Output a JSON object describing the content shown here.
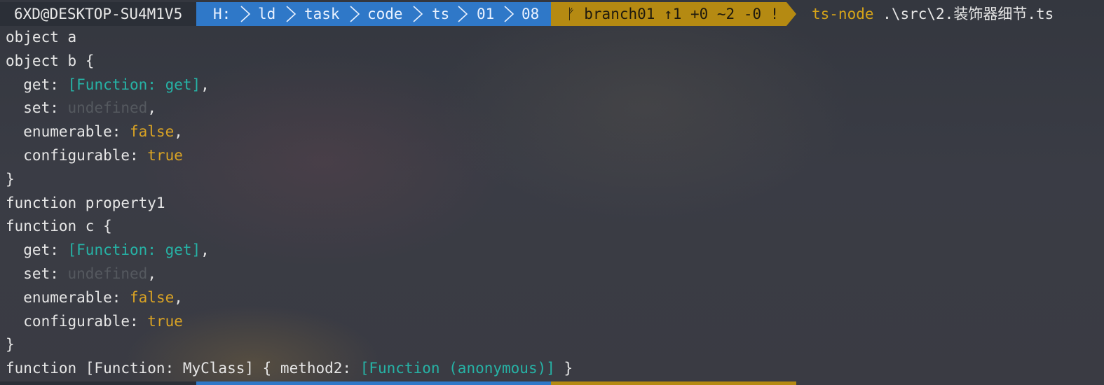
{
  "prompt": {
    "host": "6XD@DESKTOP-SU4M1V5",
    "path": [
      "H:",
      "ld",
      "task",
      "code",
      "ts",
      "01",
      "08"
    ],
    "git": {
      "icon": "git-branch-icon",
      "text": "branch01 ↑1 +0 ~2 -0 !"
    },
    "command": "ts-node",
    "argument": ".\\src\\2.装饰器细节.ts"
  },
  "colors": {
    "host_bg": "#2b2f37",
    "path_bg": "#2f78c8",
    "git_bg": "#b58a12",
    "command": "#d6a419",
    "function_literal": "#26b3a6",
    "undefined_literal": "#55595f",
    "boolean_literal": "#d9a324"
  },
  "output": {
    "l1": "object a",
    "l2": "object b {",
    "l3_key": "  get: ",
    "l3_val": "[Function: get]",
    "l3_end": ",",
    "l4_key": "  set: ",
    "l4_val": "undefined",
    "l4_end": ",",
    "l5_key": "  enumerable: ",
    "l5_val": "false",
    "l5_end": ",",
    "l6_key": "  configurable: ",
    "l6_val": "true",
    "l7": "}",
    "l8": "function property1",
    "l9": "function c {",
    "l10_key": "  get: ",
    "l10_val": "[Function: get]",
    "l10_end": ",",
    "l11_key": "  set: ",
    "l11_val": "undefined",
    "l11_end": ",",
    "l12_key": "  enumerable: ",
    "l12_val": "false",
    "l12_end": ",",
    "l13_key": "  configurable: ",
    "l13_val": "true",
    "l14": "}",
    "l15_pre": "function [Function: MyClass] { method2: ",
    "l15_val": "[Function (anonymous)]",
    "l15_end": " }"
  }
}
